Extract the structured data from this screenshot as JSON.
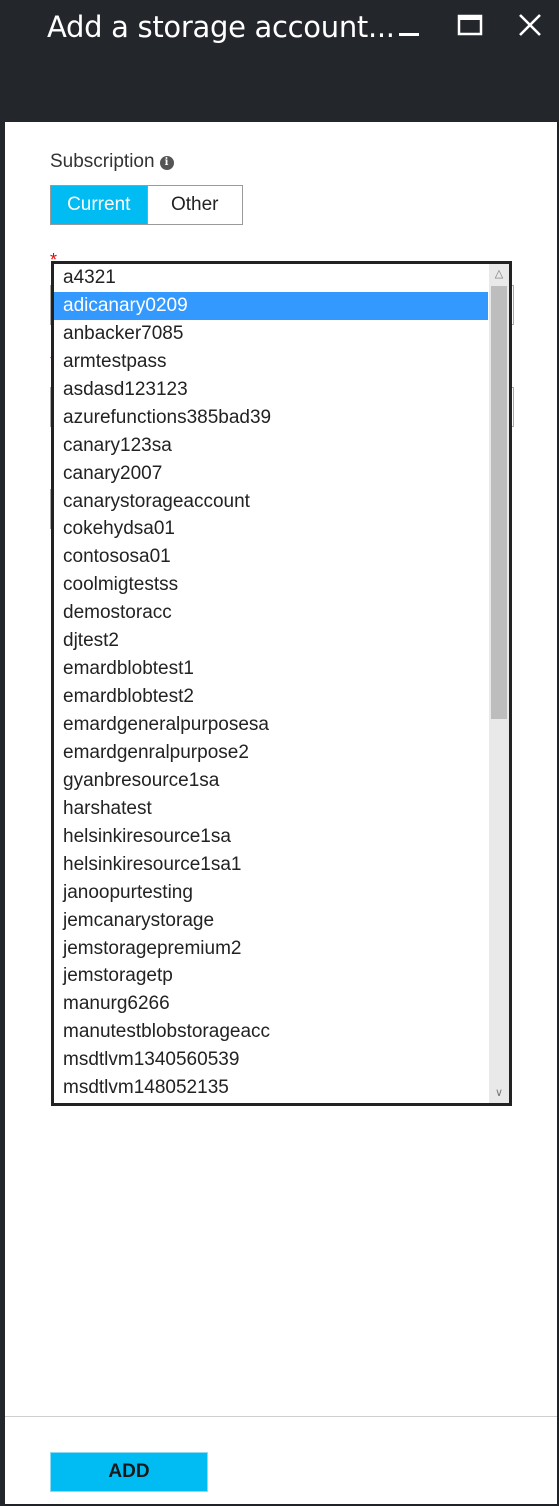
{
  "window": {
    "title": "Add a storage account...",
    "minimize_icon": "minimize-icon",
    "maximize_icon": "maximize-icon",
    "close_icon": "close-icon"
  },
  "subscription": {
    "label": "Subscription",
    "info_icon": "info-icon",
    "options": [
      {
        "label": "Current",
        "selected": true
      },
      {
        "label": "Other",
        "selected": false
      }
    ]
  },
  "dropdown": {
    "selected": "adicanary0209",
    "items": [
      "a4321",
      "adicanary0209",
      "anbacker7085",
      "armtestpass",
      "asdasd123123",
      "azurefunctions385bad39",
      "canary123sa",
      "canary2007",
      "canarystorageaccount",
      "cokehydsa01",
      "contososa01",
      "coolmigtestss",
      "demostoracc",
      "djtest2",
      "emardblobtest1",
      "emardblobtest2",
      "emardgeneralpurposesa",
      "emardgenralpurpose2",
      "gyanbresource1sa",
      "harshatest",
      "helsinkiresource1sa",
      "helsinkiresource1sa1",
      "janoopurtesting",
      "jemcanarystorage",
      "jemstoragepremium2",
      "jemstoragetp",
      "manurg6266",
      "manutestblobstorageacc",
      "msdtlvm1340560539",
      "msdtlvm148052135"
    ]
  },
  "footer": {
    "add_label": "ADD"
  },
  "colors": {
    "header_bg": "#23262b",
    "accent": "#00bcf2",
    "selection": "#3399ff"
  }
}
